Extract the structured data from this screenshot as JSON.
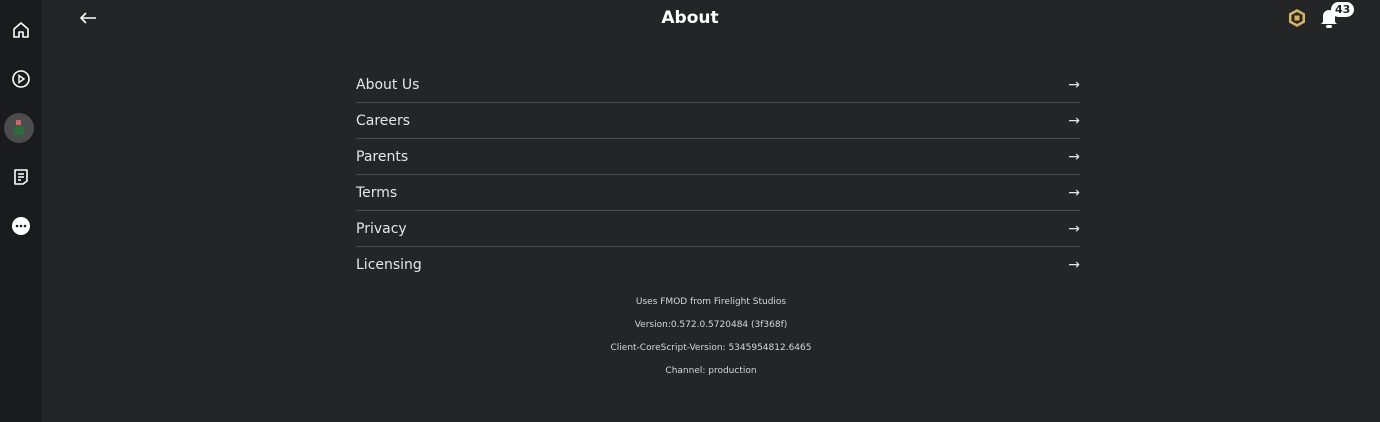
{
  "header": {
    "title": "About",
    "notification_count": "43"
  },
  "sidebar": {
    "items": [
      "home",
      "discover",
      "avatar",
      "chat",
      "more"
    ]
  },
  "menu": [
    {
      "label": "About Us"
    },
    {
      "label": "Careers"
    },
    {
      "label": "Parents"
    },
    {
      "label": "Terms"
    },
    {
      "label": "Privacy"
    },
    {
      "label": "Licensing"
    }
  ],
  "info": {
    "fmod": "Uses FMOD from Firelight Studios",
    "version": "Version:0.572.0.5720484 (3f368f)",
    "corescript": "Client-CoreScript-Version: 5345954812.6465",
    "channel": "Channel: production"
  }
}
